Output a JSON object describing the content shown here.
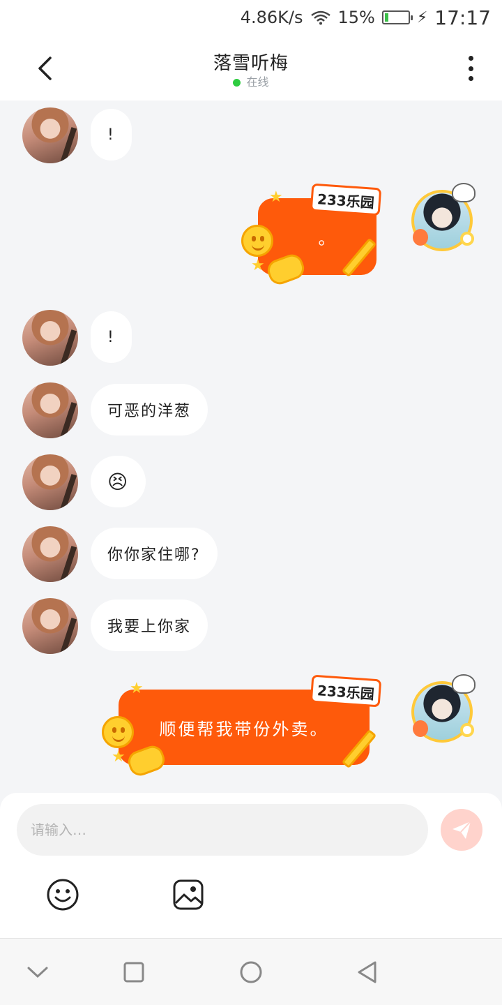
{
  "status_bar": {
    "speed": "4.86K/s",
    "battery_percent": "15%",
    "battery_level": 0.15,
    "time": "17:17"
  },
  "header": {
    "title": "落雪听梅",
    "status": "在线"
  },
  "messages": [
    {
      "side": "left",
      "text": "!"
    },
    {
      "side": "right",
      "type": "233-bubble",
      "text": "。",
      "logo": "233乐园"
    },
    {
      "side": "left",
      "text": "!"
    },
    {
      "side": "left",
      "text": "可恶的洋葱"
    },
    {
      "side": "left",
      "text": "😣"
    },
    {
      "side": "left",
      "text": "你你家住哪?"
    },
    {
      "side": "left",
      "text": "我要上你家"
    },
    {
      "side": "right",
      "type": "233-bubble",
      "text": "顺便帮我带份外卖。",
      "logo": "233乐园"
    }
  ],
  "input": {
    "placeholder": "请输入…",
    "value": ""
  },
  "toolbar": {
    "emoji": "smiley-icon",
    "image": "image-icon"
  },
  "colors": {
    "accent": "#fe5a0b",
    "online": "#2ecc40",
    "send_disabled": "#ffd3cc"
  }
}
